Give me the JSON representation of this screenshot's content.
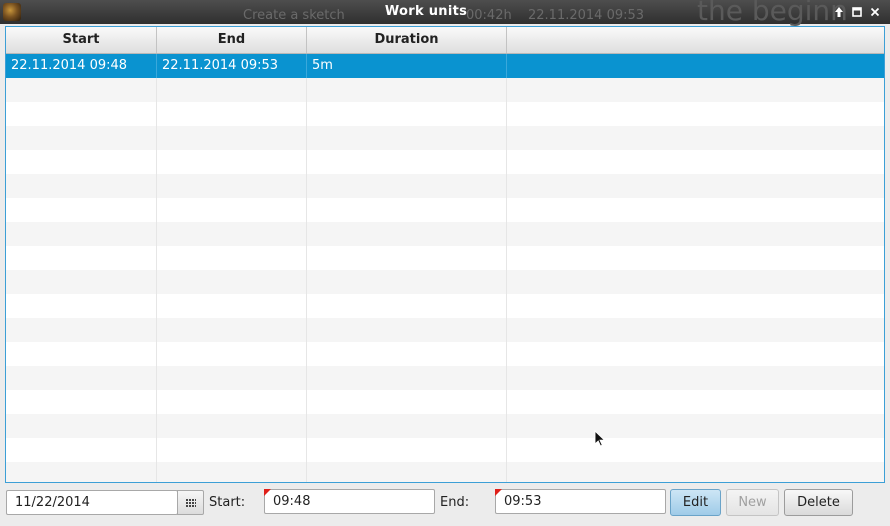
{
  "window": {
    "title": "Work units",
    "background_text": {
      "left": "Create a sketch",
      "mid": "00:42h",
      "right": "22.11.2014 09:53",
      "big": "the beginn"
    }
  },
  "table": {
    "columns": [
      "Start",
      "End",
      "Duration",
      ""
    ],
    "rows": [
      {
        "start": "22.11.2014 09:48",
        "end": "22.11.2014 09:53",
        "duration": "5m",
        "extra": ""
      }
    ],
    "selected_row": 0
  },
  "toolbar": {
    "date_value": "11/22/2014",
    "start_label": "Start:",
    "start_value": "09:48",
    "end_label": "End:",
    "end_value": "09:53",
    "edit_label": "Edit",
    "new_label": "New",
    "delete_label": "Delete"
  },
  "colors": {
    "selection": "#0a93d0",
    "panel_border": "#3c9fd6",
    "invalid_marker": "#e0201a"
  },
  "icons": [
    "app-icon",
    "pin-icon",
    "maximize-icon",
    "close-icon",
    "calendar-icon",
    "mouse-cursor"
  ]
}
